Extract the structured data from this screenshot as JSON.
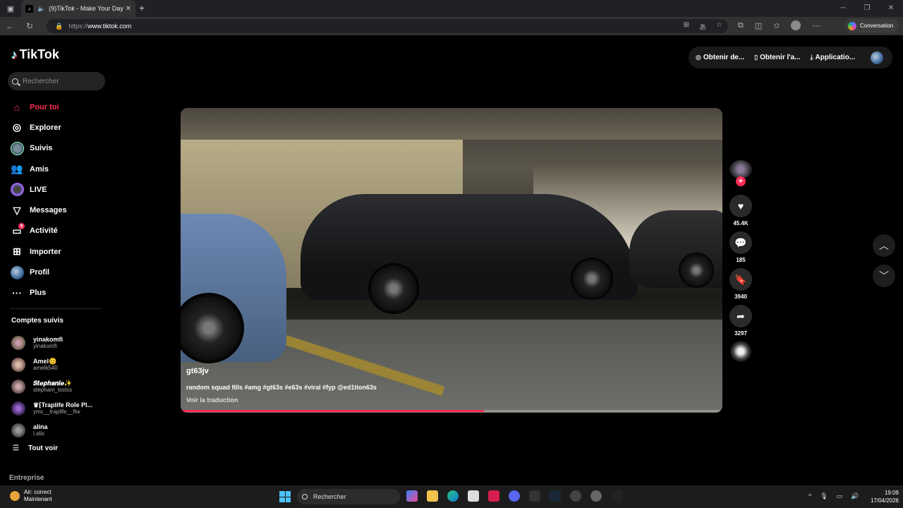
{
  "browser": {
    "tab_title": "(9)TikTok - Make Your Day",
    "url_protocol": "https://",
    "url_host": "www.tiktok.com",
    "conversation_label": "Conversation"
  },
  "tiktok": {
    "logo": "TikTok",
    "search_placeholder": "Rechercher",
    "nav": [
      {
        "label": "Pour toi",
        "icon": "home-icon"
      },
      {
        "label": "Explorer",
        "icon": "compass-icon"
      },
      {
        "label": "Suivis",
        "icon": "following-avatar-icon"
      },
      {
        "label": "Amis",
        "icon": "friends-icon"
      },
      {
        "label": "LIVE",
        "icon": "live-icon"
      },
      {
        "label": "Messages",
        "icon": "messages-icon"
      },
      {
        "label": "Activité",
        "icon": "activity-icon",
        "badge": "9"
      },
      {
        "label": "Importer",
        "icon": "upload-icon"
      },
      {
        "label": "Profil",
        "icon": "profile-icon"
      },
      {
        "label": "Plus",
        "icon": "more-icon"
      }
    ],
    "following_title": "Comptes suivis",
    "following": [
      {
        "name": "yinakomfi",
        "handle": "yinakomfi"
      },
      {
        "name": "Amel😊",
        "handle": "amelk540"
      },
      {
        "name": "𝑺𝒕𝒆𝒑𝒉𝒂𝒏𝒊𝒆✨",
        "handle": "stephani_tsstss"
      },
      {
        "name": "♛⁅Traplife Role Pl...",
        "handle": "ymc__traplife__ftw"
      },
      {
        "name": "alina",
        "handle": "l.alix"
      }
    ],
    "see_all": "Tout voir",
    "entreprise": "Entreprise",
    "top_buttons": [
      "Obtenir de...",
      "Obtenir l'a...",
      "Applicatio..."
    ],
    "video": {
      "username": "gt63jv",
      "caption": "random squad fills #amg #gt63s #e63s #viral #fyp @ed1tion63s",
      "translate": "Voir la traduction",
      "progress": 0.56
    },
    "actions": {
      "likes": "45.4K",
      "comments": "185",
      "saves": "3940",
      "shares": "3297"
    }
  },
  "taskbar": {
    "weather_line1": "Air: correct",
    "weather_line2": "Maintenant",
    "search_label": "Rechercher",
    "time": "19:09",
    "date": "17/04/2026"
  },
  "colors": {
    "accent": "#fe2c55",
    "background": "#000000"
  }
}
